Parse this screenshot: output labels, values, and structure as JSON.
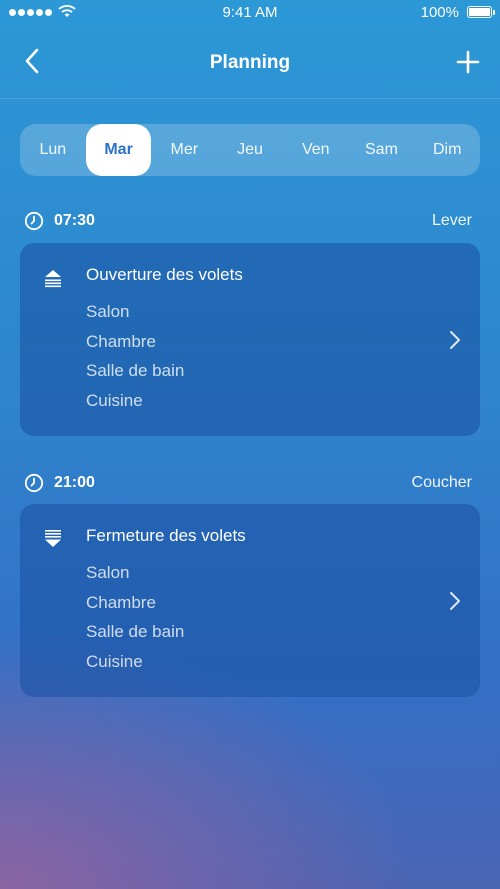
{
  "status_bar": {
    "time": "9:41 AM",
    "battery": "100%"
  },
  "nav": {
    "title": "Planning"
  },
  "days": [
    "Lun",
    "Mar",
    "Mer",
    "Jeu",
    "Ven",
    "Sam",
    "Dim"
  ],
  "selected_day": "Mar",
  "events": [
    {
      "time": "07:30",
      "moment": "Lever",
      "action": "Ouverture des volets",
      "icon": "shutter-open-icon",
      "rooms": [
        "Salon",
        "Chambre",
        "Salle de bain",
        "Cuisine"
      ]
    },
    {
      "time": "21:00",
      "moment": "Coucher",
      "action": "Fermeture des volets",
      "icon": "shutter-close-icon",
      "rooms": [
        "Salon",
        "Chambre",
        "Salle de bain",
        "Cuisine"
      ]
    }
  ],
  "colors": {
    "accent": "#2a73c9",
    "background_top": "#2c98d6",
    "card": "#1a50a0"
  }
}
